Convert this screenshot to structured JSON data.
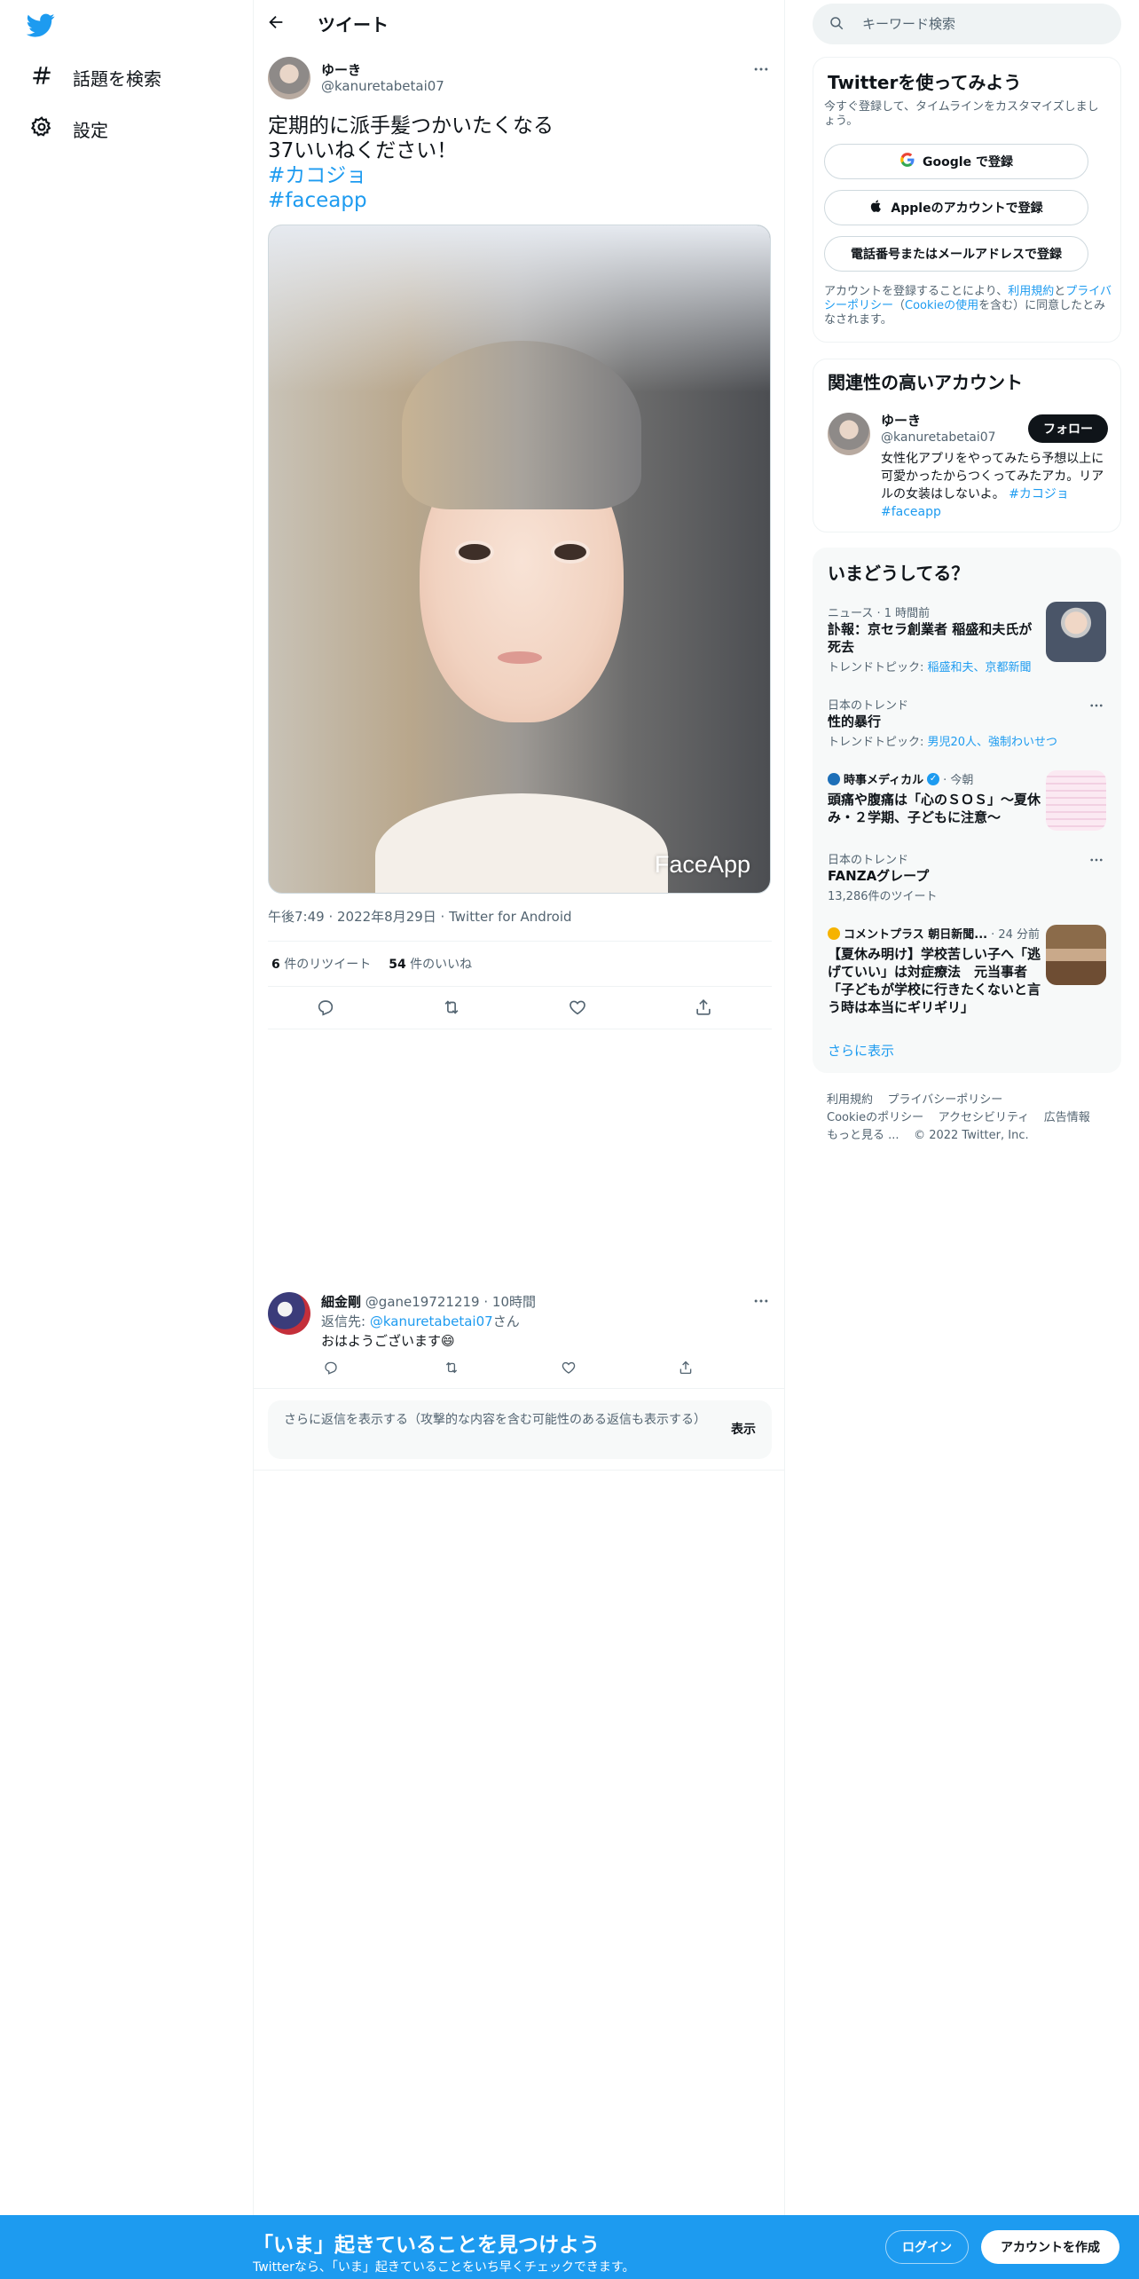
{
  "nav": {
    "logo_icon": "twitter-bird-icon",
    "items": [
      {
        "label": "話題を検索",
        "icon": "hashtag-icon"
      },
      {
        "label": "設定",
        "icon": "gear-icon"
      }
    ]
  },
  "header": {
    "title": "ツイート",
    "back_icon": "back-arrow-icon"
  },
  "tweet": {
    "author_name": "ゆーき",
    "author_handle": "@kanuretabetai07",
    "lines": [
      "定期的に派手髪つかいたくなる",
      "37いいねください！"
    ],
    "hashtags": [
      "#カコジョ",
      "#faceapp"
    ],
    "media_watermark": "FaceApp",
    "meta": "午後7:49 · 2022年8月29日 · Twitter for Android",
    "retweets_count": "6",
    "retweets_label": "件のリツイート",
    "likes_count": "54",
    "likes_label": "件のいいね"
  },
  "reply": {
    "name": "細金剛",
    "handle": "@gane19721219",
    "time": "· 10時間",
    "reply_to_prefix": "返信先: ",
    "reply_to_handle": "@kanuretabetai07",
    "reply_to_suffix": "さん",
    "text": "おはようございます😄"
  },
  "show_more": {
    "text": "さらに返信を表示する（攻撃的な内容を含む可能性のある返信も表示する）",
    "button": "表示"
  },
  "search": {
    "placeholder": "キーワード検索"
  },
  "signup_card": {
    "title": "Twitterを使ってみよう",
    "subtitle": "今すぐ登録して、タイムラインをカスタマイズしましょう。",
    "google_btn": "Google で登録",
    "apple_btn": "Appleのアカウントで登録",
    "phone_btn": "電話番号またはメールアドレスで登録",
    "legal_prefix": "アカウントを登録することにより、",
    "terms_link": "利用規約",
    "and": "と",
    "privacy_link": "プライバシーポリシー",
    "cookie_open": "（",
    "cookie_link": "Cookieの使用",
    "legal_suffix": "を含む）に同意したとみなされます。"
  },
  "related_card": {
    "title": "関連性の高いアカウント",
    "name": "ゆーき",
    "handle": "@kanuretabetai07",
    "follow": "フォロー",
    "bio": "女性化アプリをやってみたら予想以上に可愛かったからつくってみたアカ。リアルの女装はしないよ。",
    "bio_tags": [
      "#カコジョ",
      "#faceapp"
    ]
  },
  "trends_card": {
    "title": "いまどうしてる？",
    "items": [
      {
        "category": "ニュース · 1 時間前",
        "title": "訃報：京セラ創業者 稲盛和夫氏が死去",
        "sub_prefix": "トレンドトピック: ",
        "sub_links": "稲盛和夫、京都新聞"
      },
      {
        "category": "日本のトレンド",
        "title": "性的暴行",
        "sub_prefix": "トレンドトピック: ",
        "sub_links": "男児20人、強制わいせつ"
      },
      {
        "category_name": "時事メディカル",
        "category_time": "· 今朝",
        "title": "頭痛や腹痛は「心のＳＯＳ」～夏休み・２学期、子どもに注意～"
      },
      {
        "category": "日本のトレンド",
        "title": "FANZAグレープ",
        "sub": "13,286件のツイート"
      },
      {
        "category_name": "コメントプラス 朝日新聞...",
        "category_time": "· 24 分前",
        "title": "【夏休み明け】学校苦しい子へ「逃げていい」は対症療法　元当事者「子どもが学校に行きたくないと言う時は本当にギリギリ」"
      }
    ],
    "show_more": "さらに表示"
  },
  "footer": {
    "line1": [
      "利用規約",
      "プライバシーポリシー"
    ],
    "line2": [
      "Cookieのポリシー",
      "アクセシビリティ",
      "広告情報"
    ],
    "line3": [
      "もっと見る ...",
      "© 2022 Twitter, Inc."
    ]
  },
  "bottom_bar": {
    "title": "「いま」起きていることを見つけよう",
    "subtitle": "Twitterなら、「いま」起きていることをいち早くチェックできます。",
    "login": "ログイン",
    "signup": "アカウントを作成"
  },
  "colors": {
    "accent": "#1d9bf0",
    "text": "#0f1419",
    "muted": "#536471"
  }
}
